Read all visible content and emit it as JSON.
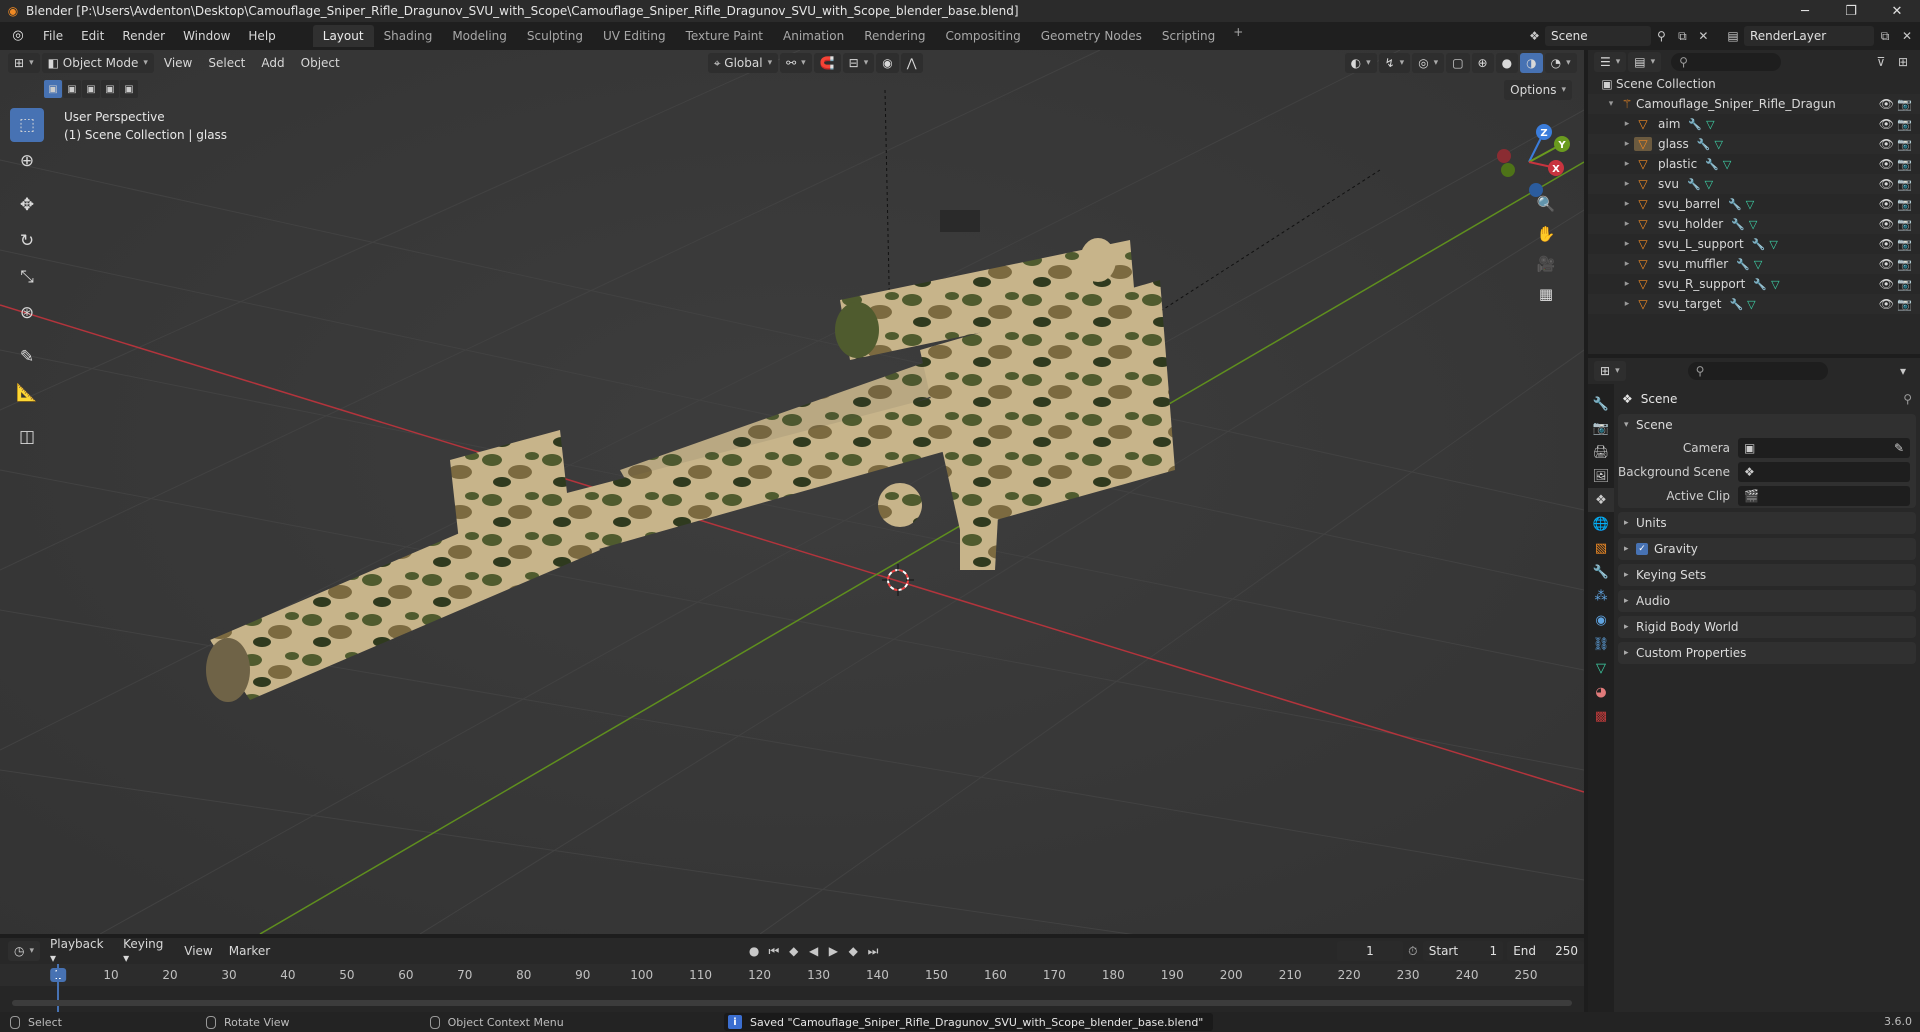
{
  "window": {
    "title": "Blender [P:\\Users\\Avdenton\\Desktop\\Camouflage_Sniper_Rifle_Dragunov_SVU_with_Scope\\Camouflage_Sniper_Rifle_Dragunov_SVU_with_Scope_blender_base.blend]",
    "minimize": "─",
    "maximize": "❐",
    "close": "✕"
  },
  "menus": [
    "File",
    "Edit",
    "Render",
    "Window",
    "Help"
  ],
  "workspaces": [
    {
      "label": "Layout",
      "active": true
    },
    {
      "label": "Shading"
    },
    {
      "label": "Modeling"
    },
    {
      "label": "Sculpting"
    },
    {
      "label": "UV Editing"
    },
    {
      "label": "Texture Paint"
    },
    {
      "label": "Animation"
    },
    {
      "label": "Rendering"
    },
    {
      "label": "Compositing"
    },
    {
      "label": "Geometry Nodes"
    },
    {
      "label": "Scripting"
    }
  ],
  "workspace_add": "+",
  "scene_selector": {
    "value": "Scene"
  },
  "layer_selector": {
    "value": "RenderLayer"
  },
  "viewport": {
    "mode": "Object Mode",
    "menus": [
      "View",
      "Select",
      "Add",
      "Object"
    ],
    "transform_orientation": "Global",
    "options_label": "Options",
    "info_line1": "User Perspective",
    "info_line2": "(1) Scene Collection | glass",
    "gizmo": {
      "x": "X",
      "y": "Y",
      "z": "Z"
    }
  },
  "outliner": {
    "root": "Scene Collection",
    "collection": "Camouflage_Sniper_Rifle_Dragunov_SVU",
    "objects": [
      {
        "name": "aim"
      },
      {
        "name": "glass",
        "selected": true
      },
      {
        "name": "plastic"
      },
      {
        "name": "svu"
      },
      {
        "name": "svu_barrel"
      },
      {
        "name": "svu_holder"
      },
      {
        "name": "svu_L_support"
      },
      {
        "name": "svu_muffler"
      },
      {
        "name": "svu_R_support"
      },
      {
        "name": "svu_target"
      }
    ]
  },
  "properties": {
    "context_title": "Scene",
    "scene_panel": {
      "title": "Scene",
      "camera_label": "Camera",
      "background_scene_label": "Background Scene",
      "active_clip_label": "Active Clip"
    },
    "panels": [
      "Units",
      "Gravity",
      "Keying Sets",
      "Audio",
      "Rigid Body World",
      "Custom Properties"
    ],
    "gravity_checked": true
  },
  "timeline": {
    "menus": [
      "Playback",
      "Keying",
      "View",
      "Marker"
    ],
    "current_frame": "1",
    "start_label": "Start",
    "start_value": "1",
    "end_label": "End",
    "end_value": "250",
    "ruler": [
      "1",
      "10",
      "20",
      "30",
      "40",
      "50",
      "60",
      "70",
      "80",
      "90",
      "100",
      "110",
      "120",
      "130",
      "140",
      "150",
      "160",
      "170",
      "180",
      "190",
      "200",
      "210",
      "220",
      "230",
      "240",
      "250"
    ]
  },
  "statusbar": {
    "select": "Select",
    "rotate_view": "Rotate View",
    "context_menu": "Object Context Menu",
    "message": "Saved \"Camouflage_Sniper_Rifle_Dragunov_SVU_with_Scope_blender_base.blend\"",
    "version": "3.6.0"
  },
  "colors": {
    "accent": "#4772b3",
    "object_icon": "#f08a24",
    "x_axis": "#c8343f",
    "y_axis": "#6a9b1f",
    "z_axis": "#3b7ddb"
  }
}
